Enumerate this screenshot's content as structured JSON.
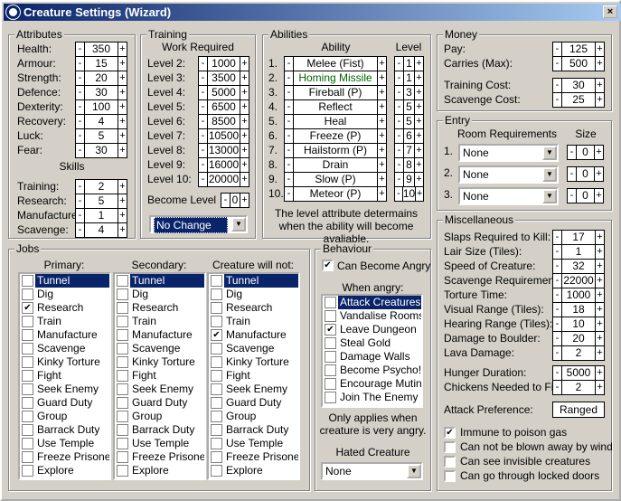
{
  "window": {
    "title": "Creature Settings (Wizard)",
    "close": "×"
  },
  "attributes": {
    "title": "Attributes",
    "items": [
      {
        "label": "Health:",
        "value": "350"
      },
      {
        "label": "Armour:",
        "value": "15"
      },
      {
        "label": "Strength:",
        "value": "20"
      },
      {
        "label": "Defence:",
        "value": "30"
      },
      {
        "label": "Dexterity:",
        "value": "100"
      },
      {
        "label": "Recovery:",
        "value": "4"
      },
      {
        "label": "Luck:",
        "value": "5"
      },
      {
        "label": "Fear:",
        "value": "30"
      }
    ],
    "skills_title": "Skills",
    "skills": [
      {
        "label": "Training:",
        "value": "2"
      },
      {
        "label": "Research:",
        "value": "5"
      },
      {
        "label": "Manufacture:",
        "value": "1"
      },
      {
        "label": "Scavenge:",
        "value": "4"
      }
    ]
  },
  "training": {
    "title": "Training",
    "subtitle": "Work Required",
    "levels": [
      {
        "label": "Level 2:",
        "value": "1000"
      },
      {
        "label": "Level 3:",
        "value": "3500"
      },
      {
        "label": "Level 4:",
        "value": "5000"
      },
      {
        "label": "Level 5:",
        "value": "6500"
      },
      {
        "label": "Level 6:",
        "value": "8500"
      },
      {
        "label": "Level 7:",
        "value": "10500"
      },
      {
        "label": "Level 8:",
        "value": "13000"
      },
      {
        "label": "Level 9:",
        "value": "16000"
      },
      {
        "label": "Level 10:",
        "value": "20000"
      }
    ],
    "become_label": "Become Level",
    "become_value": "0",
    "change": "No Change"
  },
  "abilities": {
    "title": "Abilities",
    "col_ability": "Ability",
    "col_level": "Level",
    "note": "The level attribute determains when the ability will become avaliable.",
    "highlight_color": "#006400",
    "items": [
      {
        "num": "1.",
        "name": "Melee (Fist)",
        "level": "1"
      },
      {
        "num": "2.",
        "name": "Homing Missile (P)",
        "level": "1"
      },
      {
        "num": "3.",
        "name": "Fireball (P)",
        "level": "3"
      },
      {
        "num": "4.",
        "name": "Reflect",
        "level": "5"
      },
      {
        "num": "5.",
        "name": "Heal",
        "level": "5"
      },
      {
        "num": "6.",
        "name": "Freeze (P)",
        "level": "6"
      },
      {
        "num": "7.",
        "name": "Hailstorm (P)",
        "level": "7"
      },
      {
        "num": "8.",
        "name": "Drain",
        "level": "8"
      },
      {
        "num": "9.",
        "name": "Slow (P)",
        "level": "9"
      },
      {
        "num": "10.",
        "name": "Meteor (P)",
        "level": "10"
      }
    ]
  },
  "money": {
    "title": "Money",
    "items": [
      {
        "label": "Pay:",
        "value": "125"
      },
      {
        "label": "Carries (Max):",
        "value": "500"
      },
      {
        "label": "Training Cost:",
        "value": "30"
      },
      {
        "label": "Scavenge Cost:",
        "value": "25"
      }
    ]
  },
  "entry": {
    "title": "Entry",
    "col_room": "Room Requirements",
    "col_size": "Size",
    "rows": [
      {
        "num": "1.",
        "room": "None",
        "size": "0"
      },
      {
        "num": "2.",
        "room": "None",
        "size": "0"
      },
      {
        "num": "3.",
        "room": "None",
        "size": "0"
      }
    ]
  },
  "misc": {
    "title": "Miscellaneous",
    "items": [
      {
        "label": "Slaps Required to Kill:",
        "value": "17"
      },
      {
        "label": "Lair Size (Tiles):",
        "value": "1"
      },
      {
        "label": "Speed of Creature:",
        "value": "32"
      },
      {
        "label": "Scavenge Requirement:",
        "value": "22000"
      },
      {
        "label": "Torture Time:",
        "value": "1000"
      },
      {
        "label": "Visual Range (Tiles):",
        "value": "18"
      },
      {
        "label": "Hearing Range (Tiles):",
        "value": "10"
      },
      {
        "label": "Damage to Boulder:",
        "value": "20"
      },
      {
        "label": "Lava Damage:",
        "value": "2"
      }
    ],
    "hunger": [
      {
        "label": "Hunger Duration:",
        "value": "5000"
      },
      {
        "label": "Chickens Needed to Fill:",
        "value": "2"
      }
    ],
    "attack_label": "Attack Preference:",
    "attack_value": "Ranged",
    "flags": [
      {
        "label": "Immune to poison gas",
        "checked": true
      },
      {
        "label": "Can not be blown away by wind",
        "checked": false
      },
      {
        "label": "Can see invisible creatures",
        "checked": false
      },
      {
        "label": "Can go through locked doors",
        "checked": false
      }
    ]
  },
  "jobs": {
    "title": "Jobs",
    "items": [
      "Tunnel",
      "Dig",
      "Research",
      "Train",
      "Manufacture",
      "Scavenge",
      "Kinky Torture",
      "Fight",
      "Seek Enemy",
      "Guard Duty",
      "Group",
      "Barrack Duty",
      "Use Temple",
      "Freeze Prisoners",
      "Explore"
    ],
    "columns": [
      {
        "title": "Primary:",
        "checked": [
          "Research"
        ]
      },
      {
        "title": "Secondary:",
        "checked": []
      },
      {
        "title": "Creature will not:",
        "checked": [
          "Manufacture"
        ]
      }
    ],
    "selected": "Tunnel"
  },
  "behaviour": {
    "title": "Behaviour",
    "angry_label": "Can Become Angry",
    "angry_checked": true,
    "when_label": "When angry:",
    "items": [
      {
        "label": "Attack Creatures",
        "checked": false
      },
      {
        "label": "Vandalise Rooms",
        "checked": false
      },
      {
        "label": "Leave Dungeon",
        "checked": true
      },
      {
        "label": "Steal Gold",
        "checked": false
      },
      {
        "label": "Damage Walls",
        "checked": false
      },
      {
        "label": "Become Psycho!",
        "checked": false
      },
      {
        "label": "Encourage Mutiny",
        "checked": false
      },
      {
        "label": "Join The Enemy",
        "checked": false
      }
    ],
    "note1": "Only applies when",
    "note2": "creature is very angry.",
    "hated_label": "Hated Creature",
    "hated_value": "None"
  }
}
